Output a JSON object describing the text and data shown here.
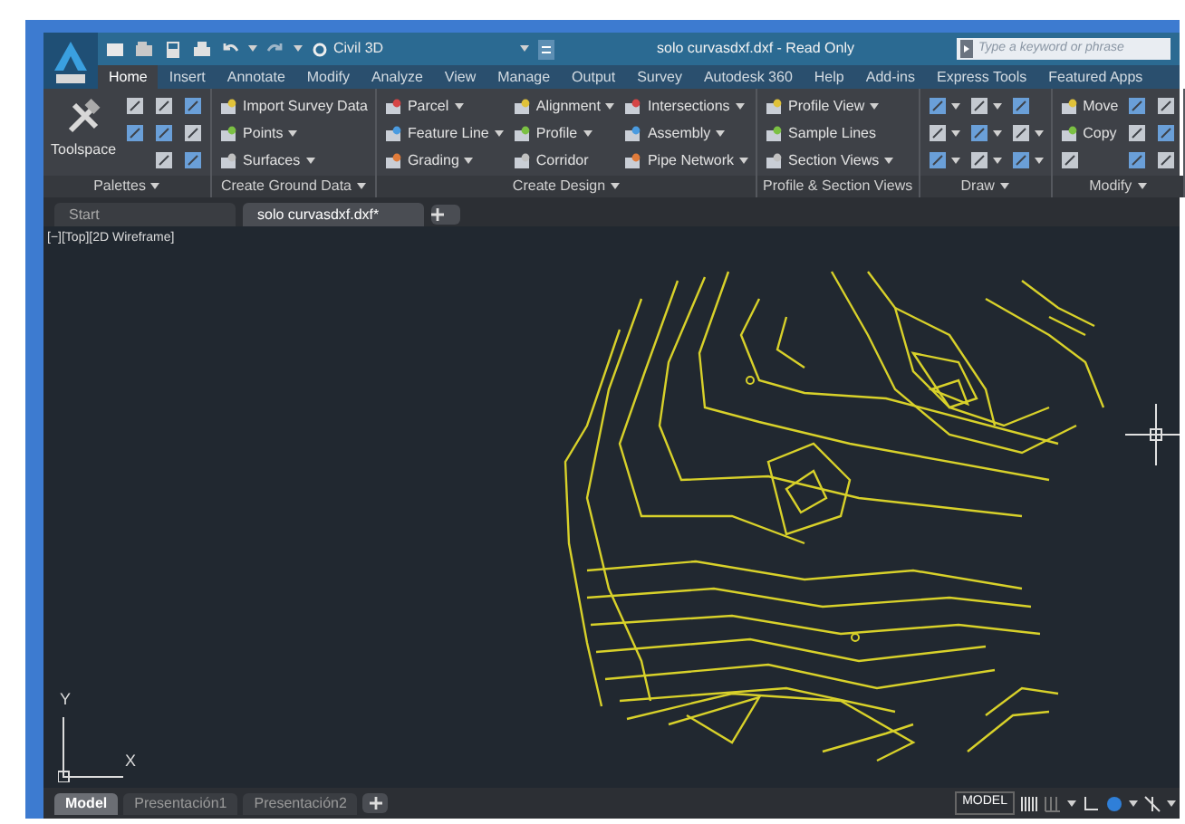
{
  "title_bar": {
    "workspace": "Civil 3D",
    "title": "solo curvasdxf.dxf - Read Only",
    "search": {
      "placeholder": "Type a keyword or phrase"
    }
  },
  "ribbon_tabs": [
    {
      "label": "Home",
      "selected": true
    },
    {
      "label": "Insert",
      "selected": false
    },
    {
      "label": "Annotate",
      "selected": false
    },
    {
      "label": "Modify",
      "selected": false
    },
    {
      "label": "Analyze",
      "selected": false
    },
    {
      "label": "View",
      "selected": false
    },
    {
      "label": "Manage",
      "selected": false
    },
    {
      "label": "Output",
      "selected": false
    },
    {
      "label": "Survey",
      "selected": false
    },
    {
      "label": "Autodesk 360",
      "selected": false
    },
    {
      "label": "Help",
      "selected": false
    },
    {
      "label": "Add-ins",
      "selected": false
    },
    {
      "label": "Express Tools",
      "selected": false
    },
    {
      "label": "Featured Apps",
      "selected": false
    }
  ],
  "ribbon_panels": [
    {
      "label": "Palettes",
      "dropdown": true,
      "columns": [
        [
          {
            "kind": "large",
            "label": "Toolspace"
          }
        ],
        [
          {
            "kind": "icon",
            "dropdown": false
          },
          {
            "kind": "icon",
            "dropdown": false
          }
        ],
        [
          {
            "kind": "icon",
            "dropdown": false
          },
          {
            "kind": "icon",
            "dropdown": false
          },
          {
            "kind": "icon",
            "dropdown": false
          }
        ],
        [
          {
            "kind": "icon",
            "dropdown": false
          },
          {
            "kind": "icon",
            "dropdown": false
          },
          {
            "kind": "icon",
            "dropdown": false
          }
        ]
      ]
    },
    {
      "label": "Create Ground Data",
      "dropdown": true,
      "columns": [
        [
          {
            "kind": "small",
            "label": "Import Survey Data",
            "dropdown": false
          },
          {
            "kind": "small",
            "label": "Points",
            "dropdown": true
          },
          {
            "kind": "small",
            "label": "Surfaces",
            "dropdown": true
          }
        ]
      ]
    },
    {
      "label": "Create Design",
      "dropdown": true,
      "columns": [
        [
          {
            "kind": "small",
            "label": "Parcel",
            "dropdown": true
          },
          {
            "kind": "small",
            "label": "Feature Line",
            "dropdown": true
          },
          {
            "kind": "small",
            "label": "Grading",
            "dropdown": true
          }
        ],
        [
          {
            "kind": "small",
            "label": "Alignment",
            "dropdown": true
          },
          {
            "kind": "small",
            "label": "Profile",
            "dropdown": true
          },
          {
            "kind": "small",
            "label": "Corridor",
            "dropdown": false
          }
        ],
        [
          {
            "kind": "small",
            "label": "Intersections",
            "dropdown": true
          },
          {
            "kind": "small",
            "label": "Assembly",
            "dropdown": true
          },
          {
            "kind": "small",
            "label": "Pipe Network",
            "dropdown": true
          }
        ]
      ]
    },
    {
      "label": "Profile & Section Views",
      "dropdown": false,
      "columns": [
        [
          {
            "kind": "small",
            "label": "Profile View",
            "dropdown": true
          },
          {
            "kind": "small",
            "label": "Sample Lines",
            "dropdown": false
          },
          {
            "kind": "small",
            "label": "Section Views",
            "dropdown": true
          }
        ]
      ]
    },
    {
      "label": "Draw",
      "dropdown": true,
      "columns": [
        [
          {
            "kind": "icon",
            "dropdown": true
          },
          {
            "kind": "icon",
            "dropdown": true
          },
          {
            "kind": "icon",
            "dropdown": true
          }
        ],
        [
          {
            "kind": "icon",
            "dropdown": true
          },
          {
            "kind": "icon",
            "dropdown": true
          },
          {
            "kind": "icon",
            "dropdown": true
          }
        ],
        [
          {
            "kind": "icon",
            "dropdown": false
          },
          {
            "kind": "icon",
            "dropdown": true
          },
          {
            "kind": "icon",
            "dropdown": true
          }
        ]
      ]
    },
    {
      "label": "Modify",
      "dropdown": true,
      "columns": [
        [
          {
            "kind": "small",
            "label": "Move",
            "dropdown": false
          },
          {
            "kind": "small",
            "label": "Copy",
            "dropdown": false
          },
          {
            "kind": "icon",
            "dropdown": false
          }
        ],
        [
          {
            "kind": "icon",
            "dropdown": false
          },
          {
            "kind": "icon",
            "dropdown": false
          },
          {
            "kind": "icon",
            "dropdown": false
          }
        ],
        [
          {
            "kind": "icon",
            "dropdown": false
          },
          {
            "kind": "icon",
            "dropdown": false
          },
          {
            "kind": "icon",
            "dropdown": false
          }
        ]
      ]
    }
  ],
  "file_tabs": [
    {
      "label": "Start",
      "selected": false
    },
    {
      "label": "solo curvasdxf.dxf*",
      "selected": true
    }
  ],
  "viewport": {
    "label": "[−][Top][2D Wireframe]",
    "axis_y": "Y",
    "axis_x": "X"
  },
  "layout_tabs": [
    {
      "label": "Model",
      "selected": true
    },
    {
      "label": "Presentación1",
      "selected": false
    },
    {
      "label": "Presentación2",
      "selected": false
    }
  ],
  "status_bar": {
    "space": "MODEL"
  }
}
